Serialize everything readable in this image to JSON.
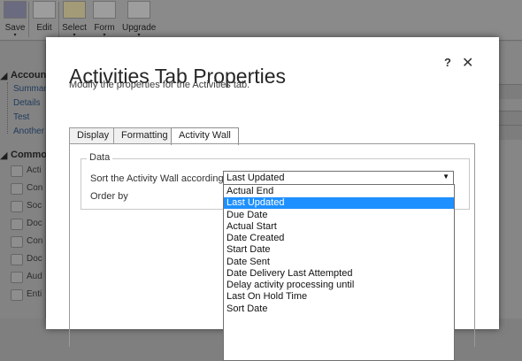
{
  "ribbon": {
    "buttons": [
      {
        "label": "Save",
        "icon": "save-icon",
        "has_menu": true
      },
      {
        "label": "Edit",
        "icon": "edit-icon",
        "has_menu": false
      },
      {
        "label": "Select",
        "icon": "select-icon",
        "has_menu": true
      },
      {
        "label": "Form",
        "icon": "form-icon",
        "has_menu": true
      },
      {
        "label": "Upgrade",
        "icon": "upgrade-icon",
        "has_menu": true
      }
    ],
    "menu_arrow": "▾"
  },
  "left_nav": {
    "account_header": "Account",
    "account_links": [
      "Summar",
      "Details",
      "Test",
      "Another"
    ],
    "common_header": "Common",
    "common_items": [
      "Acti",
      "Con",
      "Soc",
      "Doc",
      "Con",
      "Doc",
      "Aud",
      "Enti"
    ],
    "collapse_glyph": "◢"
  },
  "dialog": {
    "title": "Activities Tab Properties",
    "subtitle": "Modify the properties for the Activities tab.",
    "help_glyph": "?",
    "close_glyph": "✕",
    "tabs": [
      {
        "label": "Display",
        "active": false
      },
      {
        "label": "Formatting",
        "active": false
      },
      {
        "label": "Activity Wall",
        "active": true
      }
    ],
    "section_legend": "Data",
    "sort_label": "Sort the Activity Wall according to",
    "order_label": "Order by",
    "sort_select": {
      "value": "Last Updated",
      "arrow": "▼",
      "options": [
        "Actual End",
        "Last Updated",
        "Due Date",
        "Actual Start",
        "Date Created",
        "Start Date",
        "Date Sent",
        "Date Delivery Last Attempted",
        "Delay activity processing until",
        "Last On Hold Time",
        "Sort Date"
      ],
      "highlighted_option": "Last Updated"
    }
  },
  "colors": {
    "highlight": "#1e90ff",
    "overlay_gray": "#7f7f7f"
  }
}
